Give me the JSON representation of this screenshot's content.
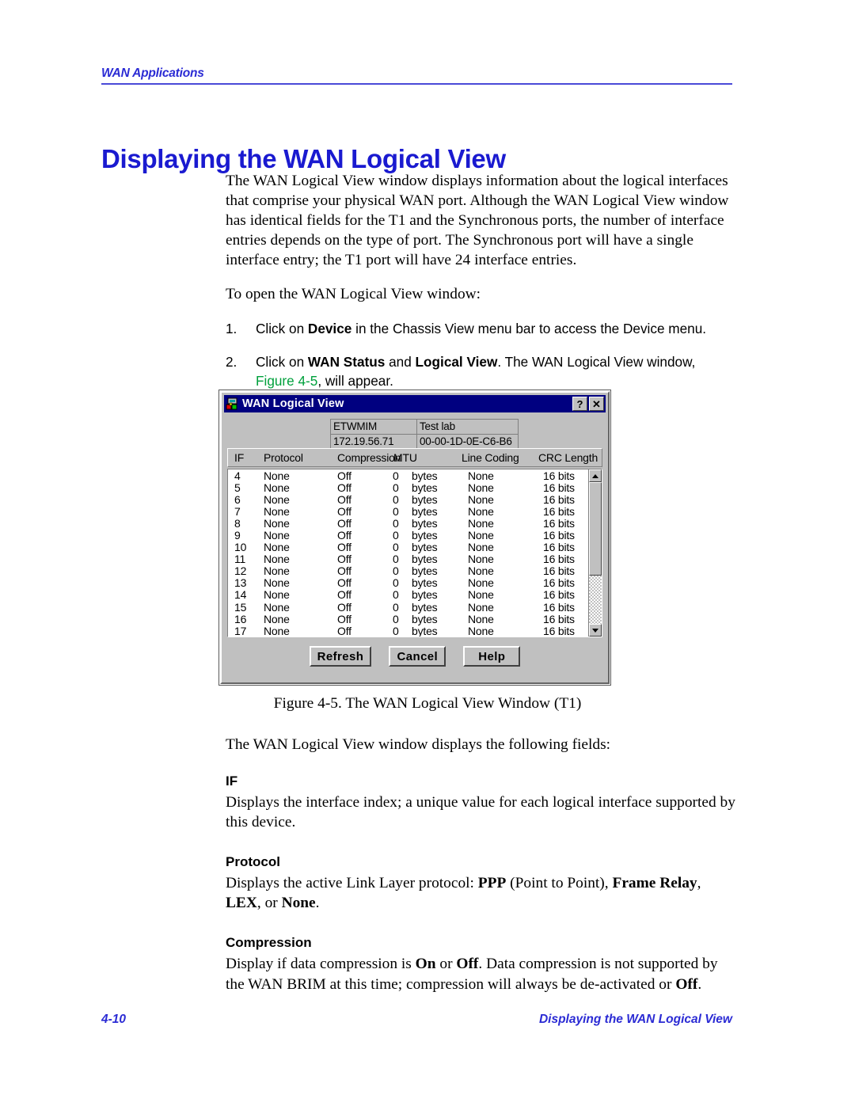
{
  "header": {
    "running_head": "WAN Applications"
  },
  "title": "Displaying the WAN Logical View",
  "intro": {
    "paragraph1": "The WAN Logical View window displays information about the logical interfaces that comprise your physical WAN port. Although the WAN Logical View window has identical fields for the T1 and the Synchronous ports, the number of interface entries depends on the type of port. The Synchronous port will have a single interface entry; the T1 port will have 24 interface entries.",
    "paragraph2": "To open the WAN Logical View window:"
  },
  "steps": [
    {
      "number": "1.",
      "parts": [
        {
          "text": "Click on ",
          "bold": false
        },
        {
          "text": "Device",
          "bold": true
        },
        {
          "text": " in the Chassis View menu bar to access the Device menu.",
          "bold": false
        }
      ]
    },
    {
      "number": "2.",
      "parts": [
        {
          "text": "Click on ",
          "bold": false
        },
        {
          "text": "WAN Status",
          "bold": true
        },
        {
          "text": " and ",
          "bold": false
        },
        {
          "text": "Logical View",
          "bold": true
        },
        {
          "text": ". The WAN Logical View window, ",
          "bold": false
        },
        {
          "text": "Figure 4-5",
          "bold": false,
          "link": true
        },
        {
          "text": ", will appear.",
          "bold": false
        }
      ]
    }
  ],
  "dialog": {
    "title": "WAN Logical View",
    "icon": "chassis-icon",
    "titlebar_buttons": [
      {
        "label": "?",
        "name": "help-button"
      },
      {
        "label": "✕",
        "name": "close-button"
      }
    ],
    "info_fields": {
      "device_type": "ETWMIM",
      "location": "Test lab",
      "ip_address": "172.19.56.71",
      "mac_address": "00-00-1D-0E-C6-B6"
    },
    "columns": [
      "IF",
      "Protocol",
      "Compression",
      "MTU",
      "Line Coding",
      "CRC Length"
    ],
    "rows": [
      {
        "if": "4",
        "protocol": "None",
        "compression": "Off",
        "mtu": "0",
        "mtu_unit": "bytes",
        "line_coding": "None",
        "crc_length": "16 bits"
      },
      {
        "if": "5",
        "protocol": "None",
        "compression": "Off",
        "mtu": "0",
        "mtu_unit": "bytes",
        "line_coding": "None",
        "crc_length": "16 bits"
      },
      {
        "if": "6",
        "protocol": "None",
        "compression": "Off",
        "mtu": "0",
        "mtu_unit": "bytes",
        "line_coding": "None",
        "crc_length": "16 bits"
      },
      {
        "if": "7",
        "protocol": "None",
        "compression": "Off",
        "mtu": "0",
        "mtu_unit": "bytes",
        "line_coding": "None",
        "crc_length": "16 bits"
      },
      {
        "if": "8",
        "protocol": "None",
        "compression": "Off",
        "mtu": "0",
        "mtu_unit": "bytes",
        "line_coding": "None",
        "crc_length": "16 bits"
      },
      {
        "if": "9",
        "protocol": "None",
        "compression": "Off",
        "mtu": "0",
        "mtu_unit": "bytes",
        "line_coding": "None",
        "crc_length": "16 bits"
      },
      {
        "if": "10",
        "protocol": "None",
        "compression": "Off",
        "mtu": "0",
        "mtu_unit": "bytes",
        "line_coding": "None",
        "crc_length": "16 bits"
      },
      {
        "if": "11",
        "protocol": "None",
        "compression": "Off",
        "mtu": "0",
        "mtu_unit": "bytes",
        "line_coding": "None",
        "crc_length": "16 bits"
      },
      {
        "if": "12",
        "protocol": "None",
        "compression": "Off",
        "mtu": "0",
        "mtu_unit": "bytes",
        "line_coding": "None",
        "crc_length": "16 bits"
      },
      {
        "if": "13",
        "protocol": "None",
        "compression": "Off",
        "mtu": "0",
        "mtu_unit": "bytes",
        "line_coding": "None",
        "crc_length": "16 bits"
      },
      {
        "if": "14",
        "protocol": "None",
        "compression": "Off",
        "mtu": "0",
        "mtu_unit": "bytes",
        "line_coding": "None",
        "crc_length": "16 bits"
      },
      {
        "if": "15",
        "protocol": "None",
        "compression": "Off",
        "mtu": "0",
        "mtu_unit": "bytes",
        "line_coding": "None",
        "crc_length": "16 bits"
      },
      {
        "if": "16",
        "protocol": "None",
        "compression": "Off",
        "mtu": "0",
        "mtu_unit": "bytes",
        "line_coding": "None",
        "crc_length": "16 bits"
      },
      {
        "if": "17",
        "protocol": "None",
        "compression": "Off",
        "mtu": "0",
        "mtu_unit": "bytes",
        "line_coding": "None",
        "crc_length": "16 bits"
      }
    ],
    "buttons": [
      {
        "label": "Refresh",
        "name": "refresh-button"
      },
      {
        "label": "Cancel",
        "name": "cancel-button"
      },
      {
        "label": "Help",
        "name": "help-button"
      }
    ],
    "colors": {
      "titlebar": "#000080",
      "face": "#c0c0c0",
      "list_background": "#ffffff"
    }
  },
  "figure_caption": "Figure 4-5.  The WAN Logical View Window (T1)",
  "fields_intro": "The WAN Logical View window displays the following fields:",
  "fields": [
    {
      "name": "IF",
      "parts": [
        {
          "text": "Displays the interface index; a unique value for each logical interface supported by this device.",
          "bold": false
        }
      ]
    },
    {
      "name": "Protocol",
      "parts": [
        {
          "text": "Displays the active Link Layer protocol: ",
          "bold": false
        },
        {
          "text": "PPP",
          "bold": true
        },
        {
          "text": " (Point to Point), ",
          "bold": false
        },
        {
          "text": "Frame Relay",
          "bold": true
        },
        {
          "text": ", ",
          "bold": false
        },
        {
          "text": "LEX",
          "bold": true
        },
        {
          "text": ", or ",
          "bold": false
        },
        {
          "text": "None",
          "bold": true
        },
        {
          "text": ".",
          "bold": false
        }
      ]
    },
    {
      "name": "Compression",
      "parts": [
        {
          "text": "Display if data compression is ",
          "bold": false
        },
        {
          "text": "On",
          "bold": true
        },
        {
          "text": " or ",
          "bold": false
        },
        {
          "text": "Off",
          "bold": true
        },
        {
          "text": ". Data compression is not supported by the WAN BRIM at this time; compression will always be de-activated or ",
          "bold": false
        },
        {
          "text": "Off",
          "bold": true
        },
        {
          "text": ".",
          "bold": false
        }
      ]
    }
  ],
  "footer": {
    "page_number": "4-10",
    "section_title": "Displaying the WAN Logical View"
  },
  "colors": {
    "heading_blue": "#1a1ad0",
    "header_blue": "#2b2bd4",
    "figure_link_green": "#00a03c"
  }
}
